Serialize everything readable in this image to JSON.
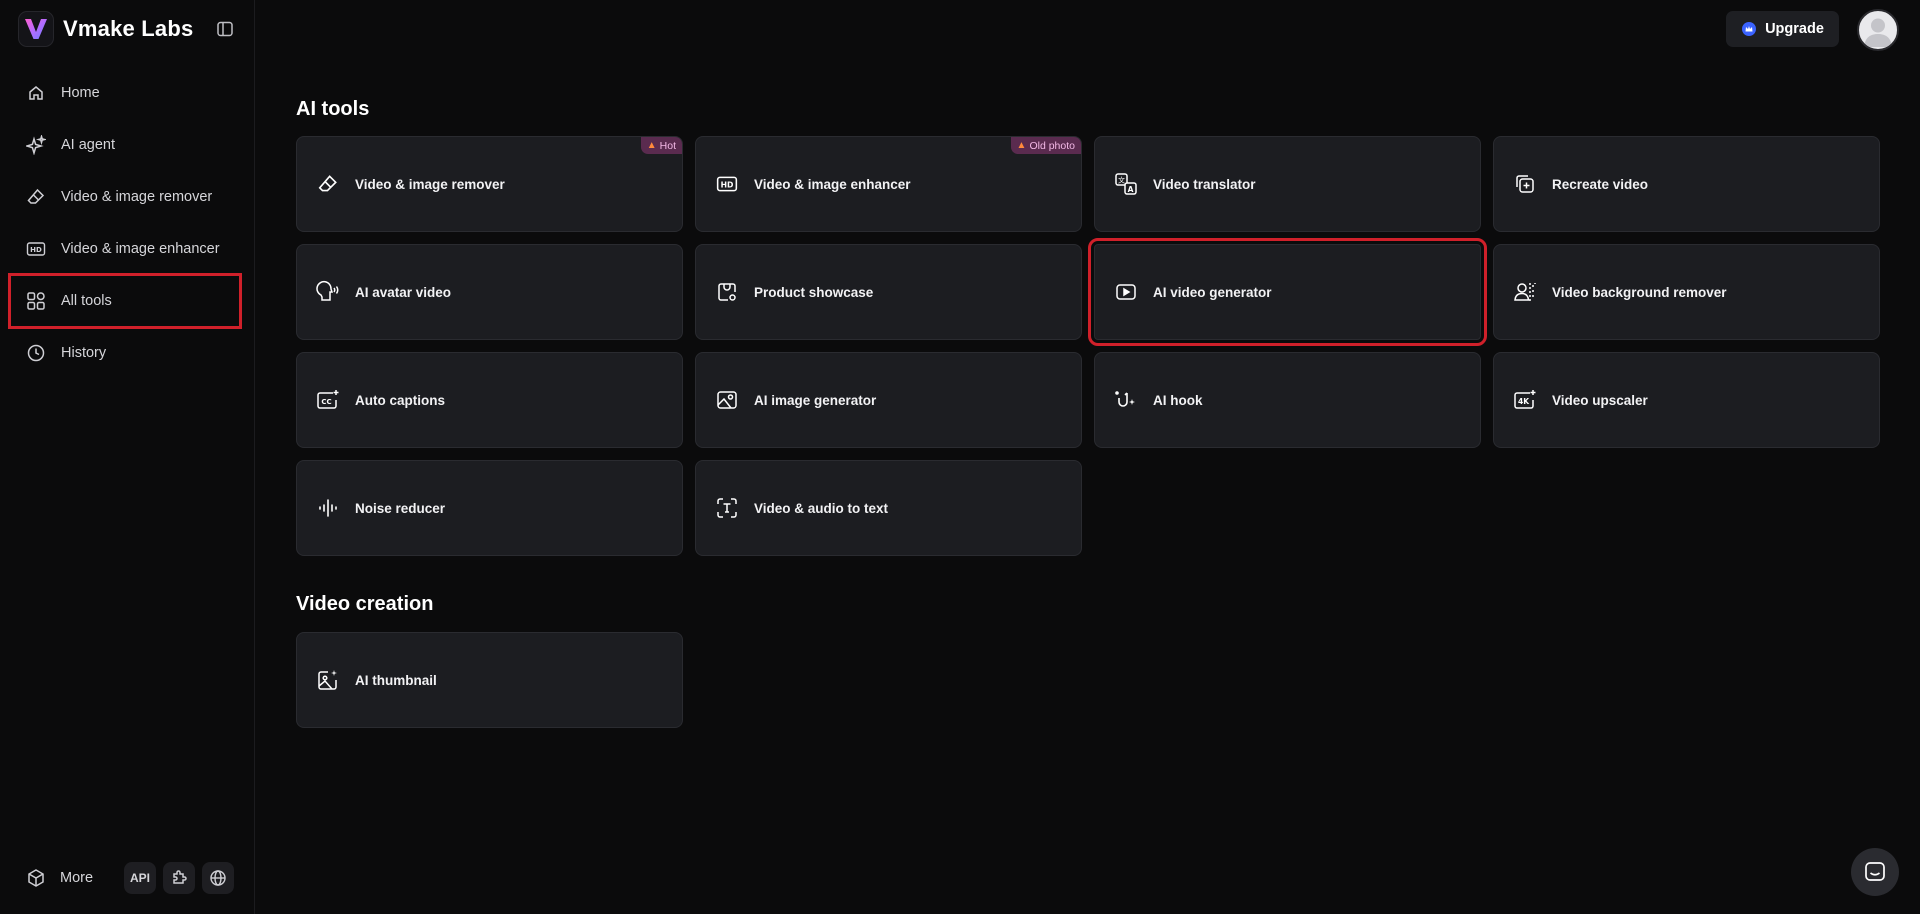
{
  "app": {
    "name": "Vmake Labs",
    "accent": "#d0202a"
  },
  "sidebar": {
    "items": [
      {
        "label": "Home",
        "icon": "home-icon"
      },
      {
        "label": "AI agent",
        "icon": "sparkle-icon"
      },
      {
        "label": "Video & image remover",
        "icon": "eraser-icon"
      },
      {
        "label": "Video & image enhancer",
        "icon": "hd-icon"
      },
      {
        "label": "All tools",
        "icon": "grid-icon",
        "active": true
      },
      {
        "label": "History",
        "icon": "clock-icon"
      }
    ],
    "footer": {
      "more_label": "More",
      "api_label": "API"
    }
  },
  "topbar": {
    "upgrade_label": "Upgrade"
  },
  "sections": [
    {
      "title": "AI tools",
      "cards": [
        {
          "label": "Video & image remover",
          "icon": "eraser-icon",
          "badge": "Hot"
        },
        {
          "label": "Video & image enhancer",
          "icon": "hd-icon",
          "badge": "Old photo"
        },
        {
          "label": "Video translator",
          "icon": "translate-icon"
        },
        {
          "label": "Recreate video",
          "icon": "recreate-icon"
        },
        {
          "label": "AI avatar video",
          "icon": "avatar-voice-icon"
        },
        {
          "label": "Product showcase",
          "icon": "product-icon"
        },
        {
          "label": "AI video generator",
          "icon": "play-icon",
          "highlighted": true
        },
        {
          "label": "Video background remover",
          "icon": "person-bg-icon"
        },
        {
          "label": "Auto captions",
          "icon": "captions-icon"
        },
        {
          "label": "AI image generator",
          "icon": "image-gen-icon"
        },
        {
          "label": "AI hook",
          "icon": "hook-icon"
        },
        {
          "label": "Video upscaler",
          "icon": "4k-icon"
        },
        {
          "label": "Noise reducer",
          "icon": "waveform-icon"
        },
        {
          "label": "Video & audio to text",
          "icon": "text-frame-icon"
        }
      ]
    },
    {
      "title": "Video creation",
      "cards": [
        {
          "label": "AI thumbnail",
          "icon": "thumbnail-icon"
        }
      ]
    }
  ]
}
